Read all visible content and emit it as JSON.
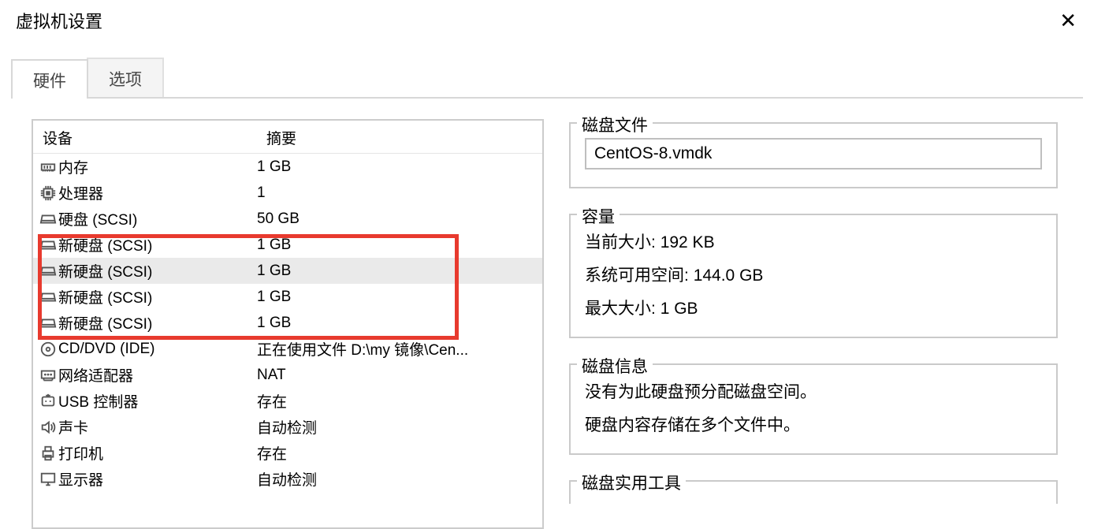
{
  "window": {
    "title": "虚拟机设置"
  },
  "tabs": {
    "hardware": "硬件",
    "options": "选项"
  },
  "columns": {
    "device": "设备",
    "summary": "摘要"
  },
  "devices": [
    {
      "icon": "memory",
      "label": "内存",
      "summary": "1 GB"
    },
    {
      "icon": "cpu",
      "label": "处理器",
      "summary": "1"
    },
    {
      "icon": "disk",
      "label": "硬盘 (SCSI)",
      "summary": "50 GB"
    },
    {
      "icon": "disk",
      "label": "新硬盘 (SCSI)",
      "summary": "1 GB"
    },
    {
      "icon": "disk",
      "label": "新硬盘 (SCSI)",
      "summary": "1 GB"
    },
    {
      "icon": "disk",
      "label": "新硬盘 (SCSI)",
      "summary": "1 GB"
    },
    {
      "icon": "disk",
      "label": "新硬盘 (SCSI)",
      "summary": "1 GB"
    },
    {
      "icon": "cd",
      "label": "CD/DVD (IDE)",
      "summary": "正在使用文件 D:\\my 镜像\\Cen..."
    },
    {
      "icon": "net",
      "label": "网络适配器",
      "summary": "NAT"
    },
    {
      "icon": "usb",
      "label": "USB 控制器",
      "summary": "存在"
    },
    {
      "icon": "sound",
      "label": "声卡",
      "summary": "自动检测"
    },
    {
      "icon": "printer",
      "label": "打印机",
      "summary": "存在"
    },
    {
      "icon": "display",
      "label": "显示器",
      "summary": "自动检测"
    }
  ],
  "detail": {
    "disk_file_legend": "磁盘文件",
    "disk_file_value": "CentOS-8.vmdk",
    "capacity_legend": "容量",
    "current_size_label": "当前大小:",
    "current_size_value": "192 KB",
    "free_space_label": "系统可用空间:",
    "free_space_value": "144.0 GB",
    "max_size_label": "最大大小:",
    "max_size_value": "1 GB",
    "disk_info_legend": "磁盘信息",
    "disk_info_line1": "没有为此硬盘预分配磁盘空间。",
    "disk_info_line2": "硬盘内容存储在多个文件中。",
    "disk_util_legend": "磁盘实用工具"
  }
}
